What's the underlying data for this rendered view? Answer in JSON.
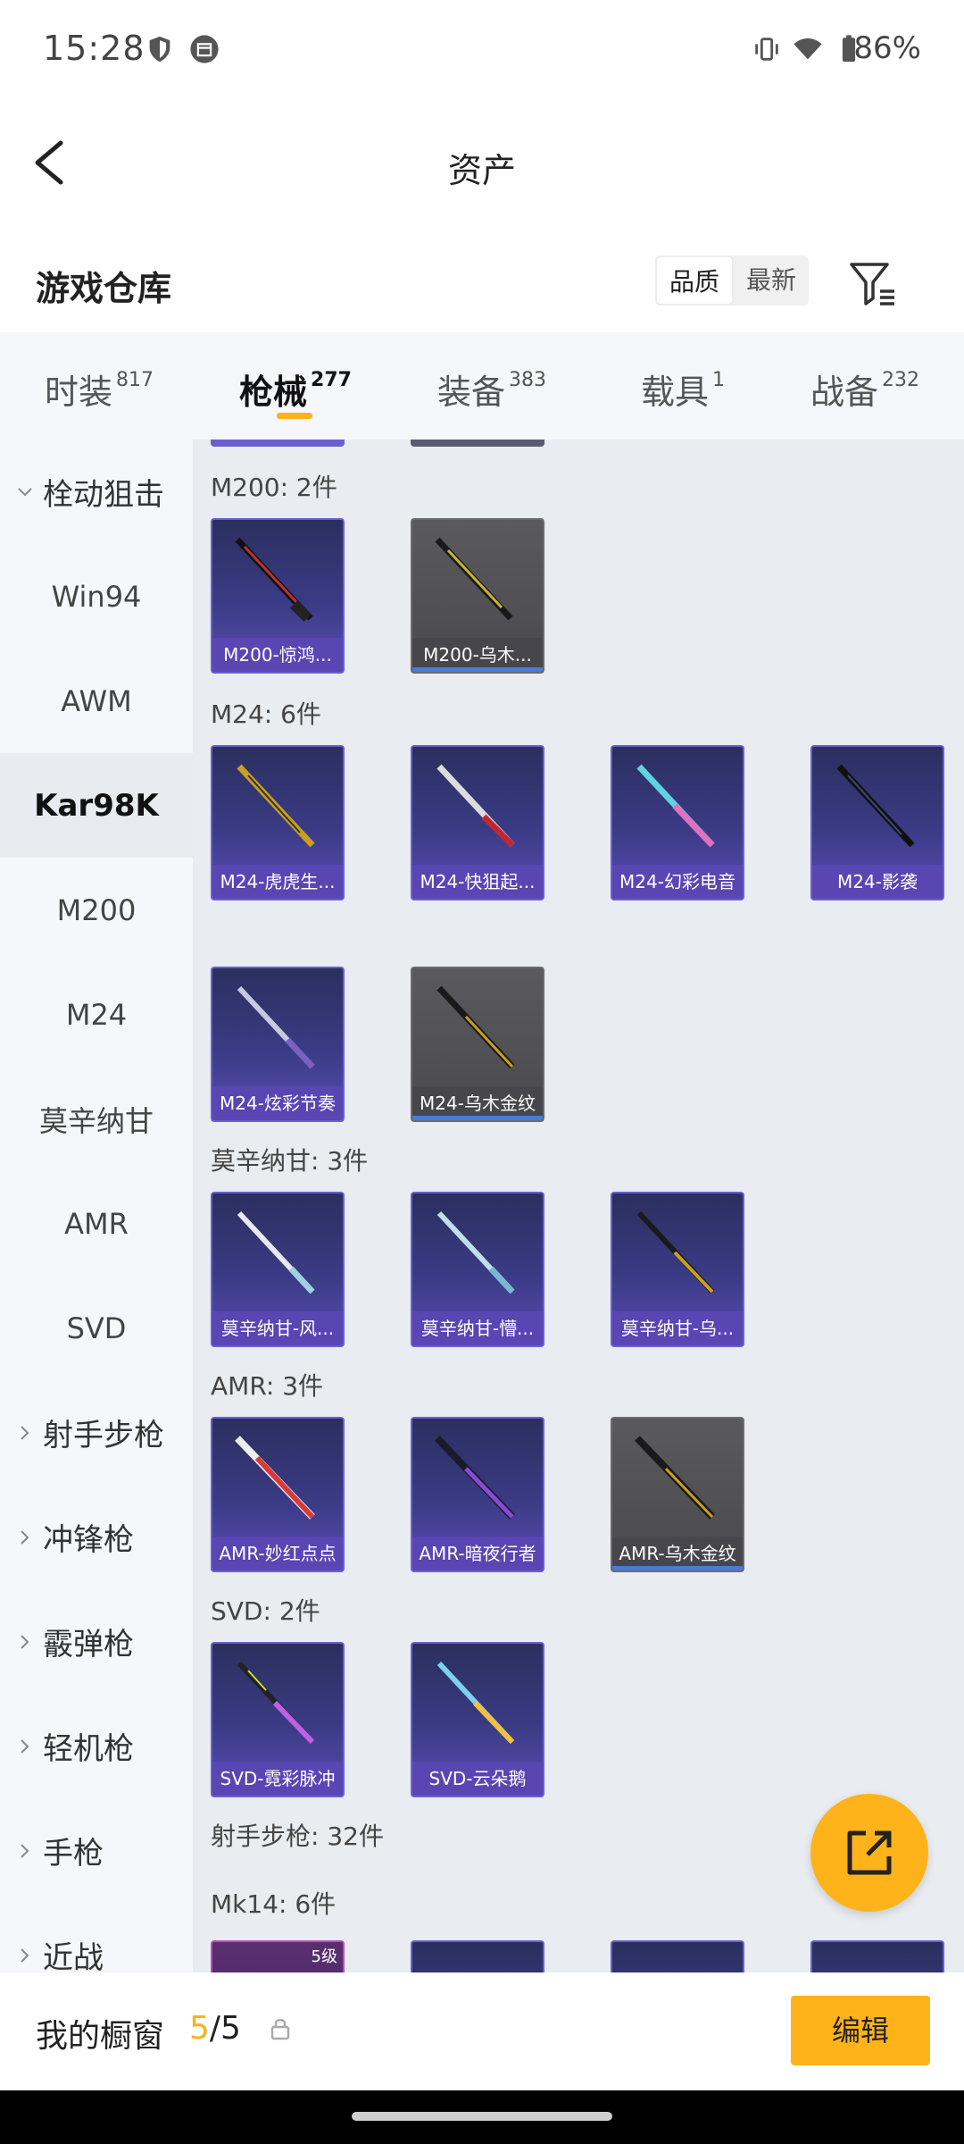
{
  "status": {
    "time": "15:28",
    "battery": "86%"
  },
  "header": {
    "title": "资产"
  },
  "subheader": {
    "section_title": "游戏仓库",
    "sort_options": [
      "品质",
      "最新"
    ]
  },
  "tabs": [
    {
      "label": "时装",
      "count": "817"
    },
    {
      "label": "枪械",
      "count": "277"
    },
    {
      "label": "装备",
      "count": "383"
    },
    {
      "label": "载具",
      "count": "1"
    },
    {
      "label": "战备",
      "count": "232"
    }
  ],
  "sidebar": {
    "group_bolt": "栓动狙击",
    "items": [
      "Win94",
      "AWM",
      "Kar98K",
      "M200",
      "M24",
      "莫辛纳甘",
      "AMR",
      "SVD"
    ],
    "groups": [
      "射手步枪",
      "冲锋枪",
      "霰弹枪",
      "轻机枪",
      "手枪",
      "近战"
    ]
  },
  "content": {
    "m200_label": "M200: 2件",
    "m200_items": [
      "M200-惊鸿...",
      "M200-乌木..."
    ],
    "m24_label": "M24: 6件",
    "m24_items": [
      "M24-虎虎生...",
      "M24-快狙起...",
      "M24-幻彩电音",
      "M24-影袭",
      "M24-炫彩节奏",
      "M24-乌木金纹"
    ],
    "mosin_label": "莫辛纳甘: 3件",
    "mosin_items": [
      "莫辛纳甘-风...",
      "莫辛纳甘-懵...",
      "莫辛纳甘-乌..."
    ],
    "amr_label": "AMR: 3件",
    "amr_items": [
      "AMR-妙红点点",
      "AMR-暗夜行者",
      "AMR-乌木金纹"
    ],
    "svd_label": "SVD: 2件",
    "svd_items": [
      "SVD-霓彩脉冲",
      "SVD-云朵鹅"
    ],
    "dmr_label": "射手步枪: 32件",
    "mk14_label": "Mk14: 6件",
    "mk14_badge": "5级"
  },
  "bottom": {
    "showcase_label": "我的橱窗",
    "showcase_current": "5",
    "showcase_sep": "/",
    "showcase_total": "5",
    "edit_label": "编辑"
  },
  "colors": {
    "accent": "#ffb31a",
    "tile_purple": "#3b3b86",
    "tile_gray": "#4a4a4e"
  }
}
